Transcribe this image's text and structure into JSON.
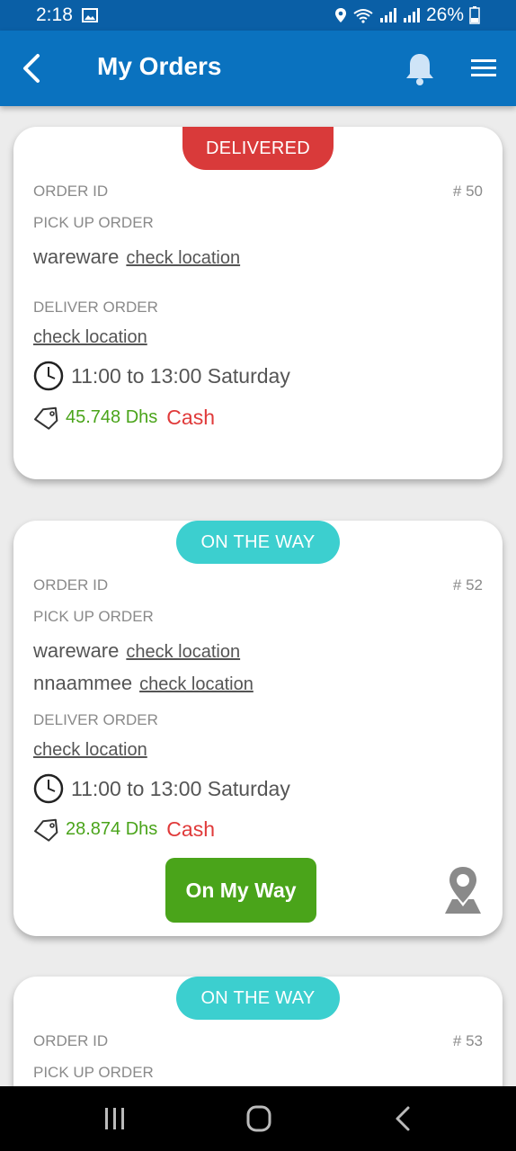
{
  "status": {
    "time": "2:18",
    "battery": "26%"
  },
  "appbar": {
    "title": "My Orders"
  },
  "orders": [
    {
      "status_label": "DELIVERED",
      "order_id_label": "ORDER ID",
      "order_id": "# 50",
      "pickup_label": "PICK UP ORDER",
      "pickups": [
        {
          "name": "wareware",
          "link": "check location"
        }
      ],
      "deliver_label": "DELIVER ORDER",
      "deliver_link": "check location",
      "time": "11:00 to 13:00 Saturday",
      "price": "45.748 Dhs",
      "payment": "Cash"
    },
    {
      "status_label": "ON THE WAY",
      "order_id_label": "ORDER ID",
      "order_id": "# 52",
      "pickup_label": "PICK UP ORDER",
      "pickups": [
        {
          "name": "wareware",
          "link": "check location"
        },
        {
          "name": "nnaammee",
          "link": "check location"
        }
      ],
      "deliver_label": "DELIVER ORDER",
      "deliver_link": "check location",
      "time": "11:00 to 13:00 Saturday",
      "price": "28.874 Dhs",
      "payment": "Cash",
      "action_label": "On My Way"
    },
    {
      "status_label": "ON THE WAY",
      "order_id_label": "ORDER ID",
      "order_id": "# 53",
      "pickup_label": "PICK UP ORDER"
    }
  ],
  "colors": {
    "appbar": "#0a72bf",
    "statusbar": "#0a5fa6",
    "delivered": "#d93a3a",
    "ontheway": "#3ccfcf",
    "price": "#4aa41a",
    "cash": "#e03a3a",
    "action": "#4aa41a"
  },
  "icons": {
    "back": "chevron-left-icon",
    "notifications": "bell-icon",
    "menu": "hamburger-icon",
    "time": "clock-icon",
    "price": "price-tag-icon",
    "map": "map-pin-icon"
  }
}
